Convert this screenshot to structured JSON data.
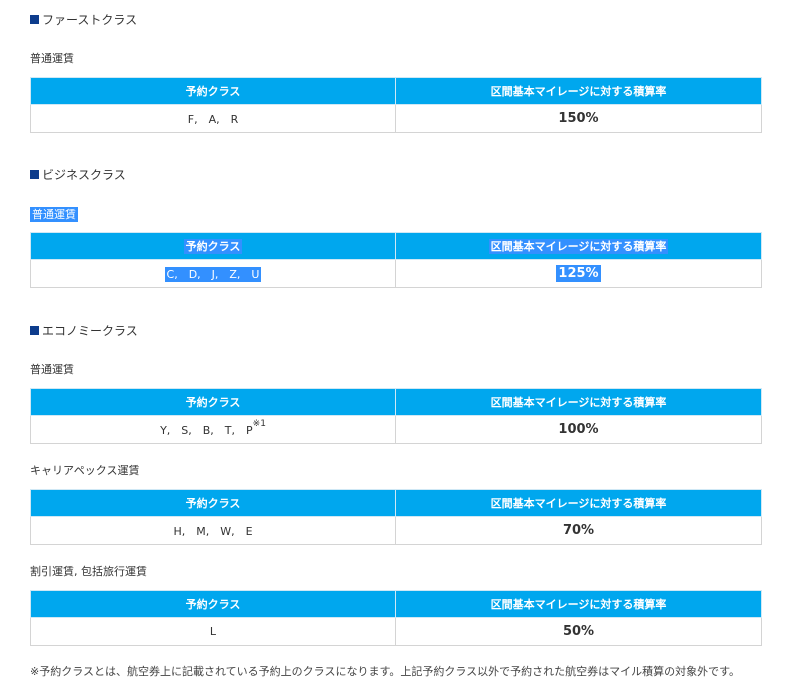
{
  "colors": {
    "header_bg": "#00a7ee",
    "section_marker": "#0d3c8c",
    "selection": "#3390ff"
  },
  "table_headers": {
    "class": "予約クラス",
    "rate": "区間基本マイレージに対する積算率"
  },
  "first": {
    "title": "ファーストクラス",
    "fares": [
      {
        "name": "普通運賃",
        "classes": "F,　A,　R",
        "rate": "150%"
      }
    ]
  },
  "business": {
    "title": "ビジネスクラス",
    "fares": [
      {
        "name": "普通運賃",
        "classes": "C,　D,　J,　Z,　U",
        "rate": "125%"
      }
    ]
  },
  "economy": {
    "title": "エコノミークラス",
    "fares": [
      {
        "name": "普通運賃",
        "classes": "Y,　S,　B,　T,　P",
        "note_mark": "※1",
        "rate": "100%"
      },
      {
        "name": "キャリアペックス運賃",
        "classes": "H,　M,　W,　E",
        "rate": "70%"
      },
      {
        "name": "割引運賃, 包括旅行運賃",
        "classes": "L",
        "rate": "50%"
      }
    ]
  },
  "footnote": "※予約クラスとは、航空券上に記載されている予約上のクラスになります。上記予約クラス以外で予約された航空券はマイル積算の対象外です。"
}
